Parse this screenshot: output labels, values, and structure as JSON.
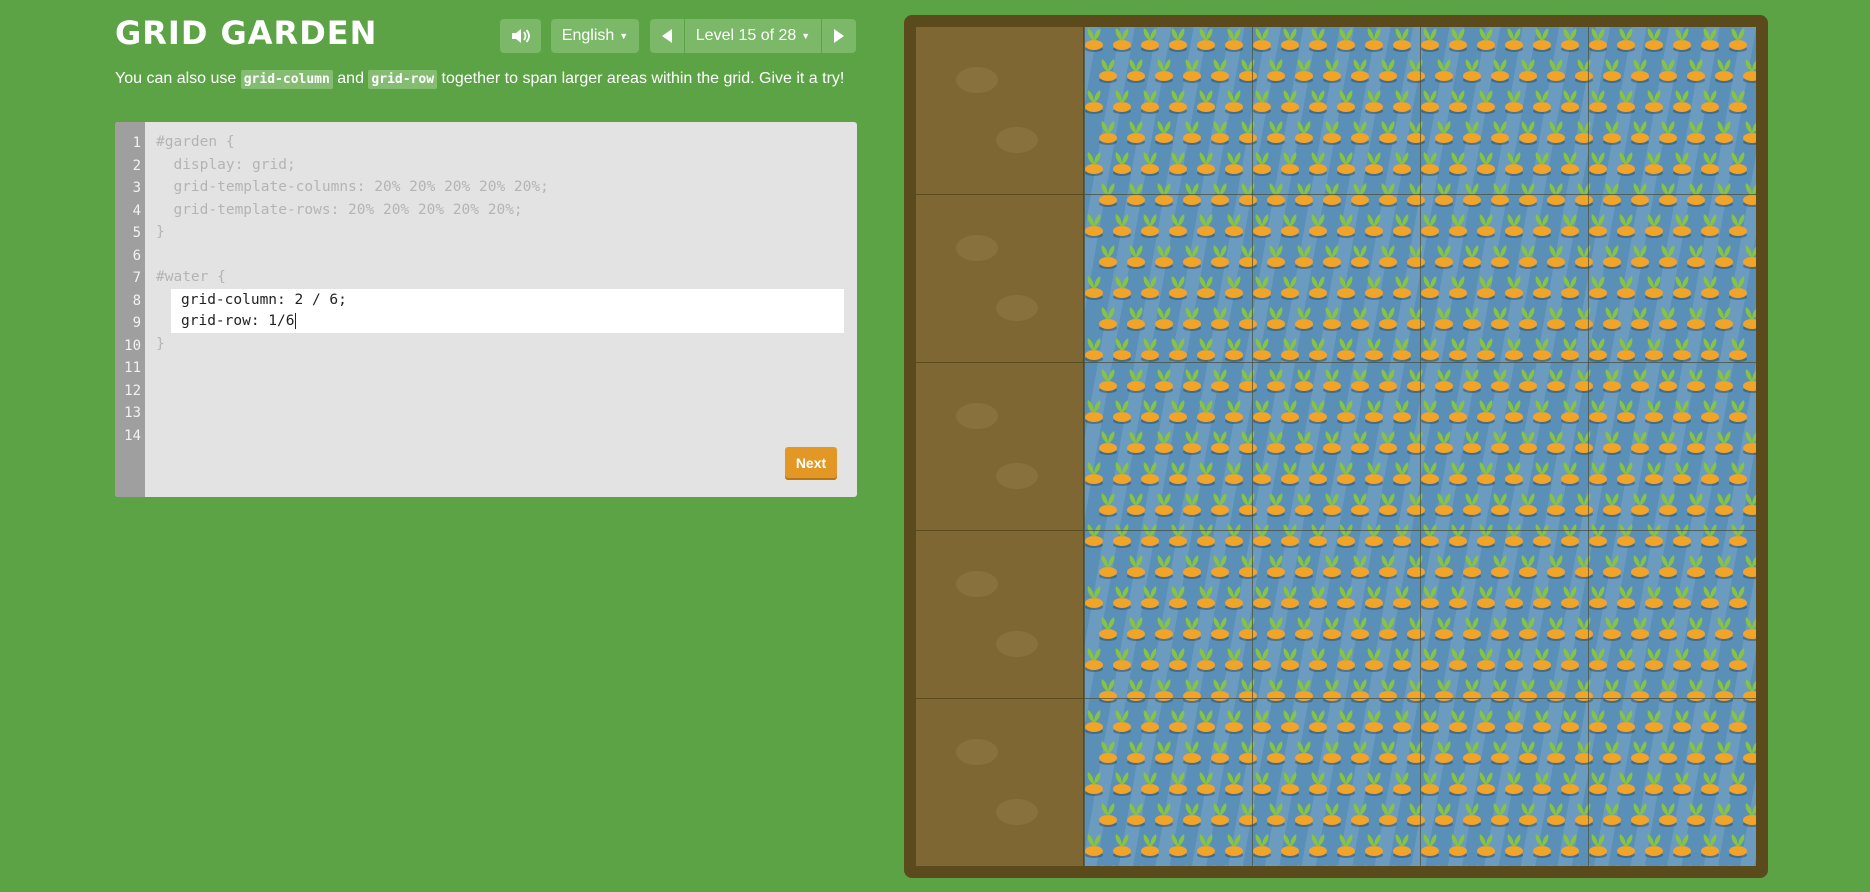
{
  "app": {
    "title": "GRID GARDEN",
    "language": "English",
    "level_label": "Level 15 of 28"
  },
  "instructions": {
    "prefix": "You can also use ",
    "code1": "grid-column",
    "middle": " and ",
    "code2": "grid-row",
    "suffix": " together to span larger areas within the grid. Give it a try!"
  },
  "editor": {
    "line_numbers": [
      "1",
      "2",
      "3",
      "4",
      "5",
      "6",
      "7",
      "8",
      "9",
      "10",
      "11",
      "12",
      "13",
      "14"
    ],
    "lines_before": [
      "#garden {",
      "  display: grid;",
      "  grid-template-columns: 20% 20% 20% 20% 20%;",
      "  grid-template-rows: 20% 20% 20% 20% 20%;",
      "}",
      "",
      "#water {"
    ],
    "input_line1": "grid-column: 2 / 6;",
    "input_line2": "grid-row: 1/6",
    "closing": "}",
    "next_label": "Next"
  },
  "colors": {
    "background": "#5ca346",
    "soil": "#7f6733",
    "water": "#5a90b8",
    "carrot": "#f2a428",
    "leaf": "#86c441",
    "next_button": "#e39725"
  },
  "icons": {
    "sound": "speaker-icon",
    "prev": "triangle-left-icon",
    "next": "triangle-right-icon",
    "carrot": "carrot-icon"
  }
}
